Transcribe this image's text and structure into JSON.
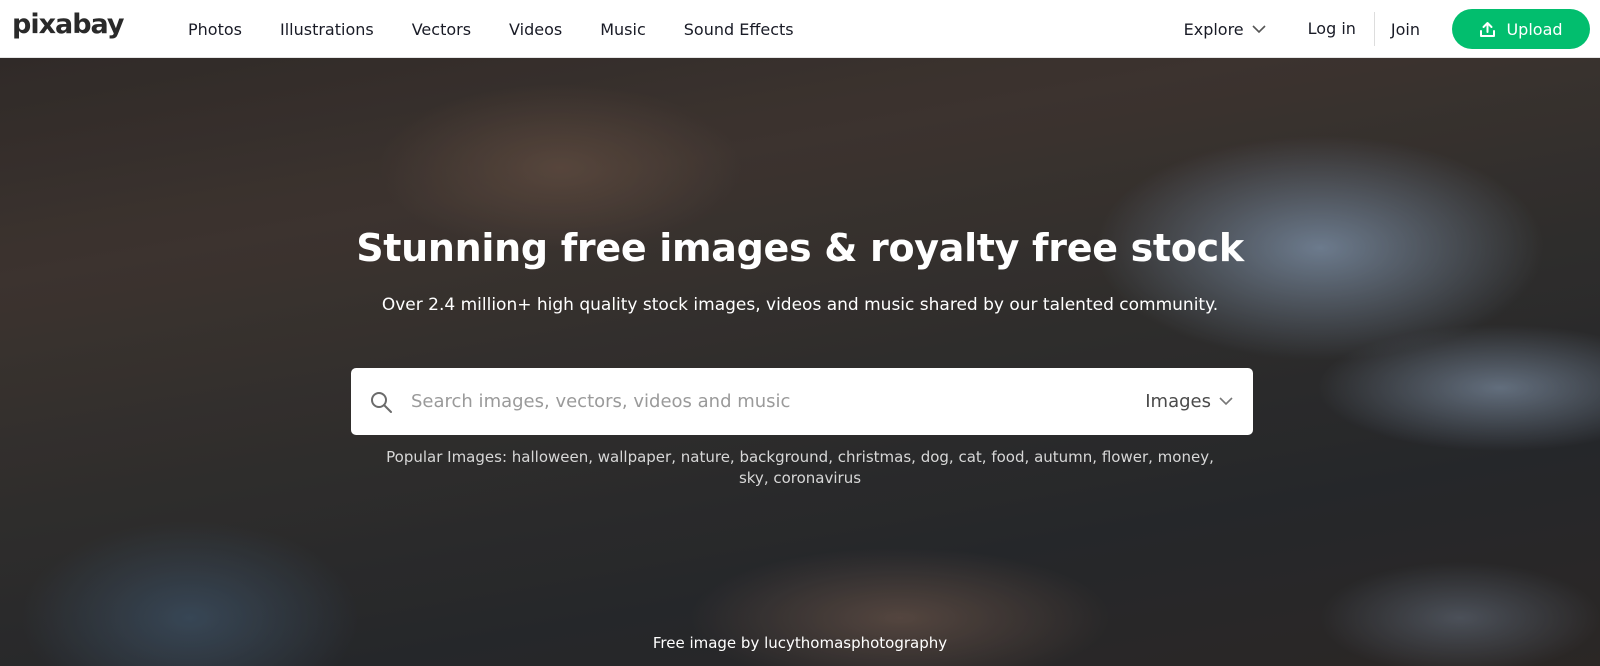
{
  "brand": {
    "logo_text": "pixabay"
  },
  "nav": {
    "items": [
      "Photos",
      "Illustrations",
      "Vectors",
      "Videos",
      "Music",
      "Sound Effects"
    ],
    "explore_label": "Explore",
    "login_label": "Log in",
    "join_label": "Join",
    "upload_label": "Upload",
    "upload_color": "#02be6e"
  },
  "hero": {
    "title": "Stunning free images & royalty free stock",
    "subtitle": "Over 2.4 million+ high quality stock images, videos and music shared by our talented community.",
    "search": {
      "placeholder": "Search images, vectors, videos and music",
      "type_label": "Images"
    },
    "popular_prefix": "Popular Images:",
    "popular_tags": [
      "halloween",
      "wallpaper",
      "nature",
      "background",
      "christmas",
      "dog",
      "cat",
      "food",
      "autumn",
      "flower",
      "money",
      "sky",
      "coronavirus"
    ],
    "credit": "Free image by lucythomasphotography"
  }
}
